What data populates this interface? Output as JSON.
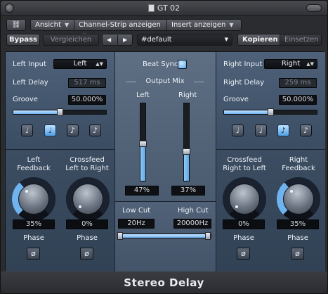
{
  "window": {
    "title": "GT 02"
  },
  "toolbar": {
    "link_icon": "link-icon",
    "view_label": "Ansicht",
    "channel_strip_label": "Channel-Strip anzeigen",
    "insert_label": "Insert anzeigen",
    "bypass_label": "Bypass",
    "compare_label": "Vergleichen",
    "prev_label": "◀",
    "next_label": "▶",
    "preset_value": "#default",
    "copy_label": "Kopieren",
    "paste_label": "Einsetzen"
  },
  "left": {
    "input_label": "Left Input",
    "input_value": "Left",
    "delay_label": "Left Delay",
    "delay_value": "517 ms",
    "groove_label": "Groove",
    "groove_value": "50.000%",
    "groove_level": 0.5,
    "notes": [
      "♩",
      "♩",
      "♪",
      "♪"
    ],
    "active_note": 1,
    "feedback_label_1": "Left",
    "feedback_label_2": "Feedback",
    "feedback_value": "35%",
    "feedback_level": 0.35,
    "crossfeed_label_1": "Crossfeed",
    "crossfeed_label_2": "Left to Right",
    "crossfeed_value": "0%",
    "crossfeed_level": 0,
    "phase_label": "Phase",
    "phase_symbol": "ø"
  },
  "center": {
    "beat_sync_label": "Beat Sync",
    "output_mix_label": "Output Mix",
    "left_label": "Left",
    "right_label": "Right",
    "left_mix_value": "47%",
    "left_mix_level": 0.47,
    "right_mix_value": "37%",
    "right_mix_level": 0.37,
    "low_cut_label": "Low Cut",
    "low_cut_value": "20Hz",
    "high_cut_label": "High Cut",
    "high_cut_value": "20000Hz"
  },
  "right": {
    "input_label": "Right Input",
    "input_value": "Right",
    "delay_label": "Right Delay",
    "delay_value": "259 ms",
    "groove_label": "Groove",
    "groove_value": "50.000%",
    "groove_level": 0.5,
    "notes": [
      "♩",
      "♩",
      "♪",
      "♪"
    ],
    "active_note": 2,
    "crossfeed_label_1": "Crossfeed",
    "crossfeed_label_2": "Right to Left",
    "crossfeed_value": "0%",
    "crossfeed_level": 0,
    "feedback_label_1": "Right",
    "feedback_label_2": "Feedback",
    "feedback_value": "35%",
    "feedback_level": 0.35,
    "phase_label": "Phase",
    "phase_symbol": "ø"
  },
  "footer": {
    "plugin_name": "Stereo Delay"
  },
  "colors": {
    "accent": "#6fb3ef",
    "panel": "#4e6178",
    "panel_dark": "#3b4d63"
  }
}
